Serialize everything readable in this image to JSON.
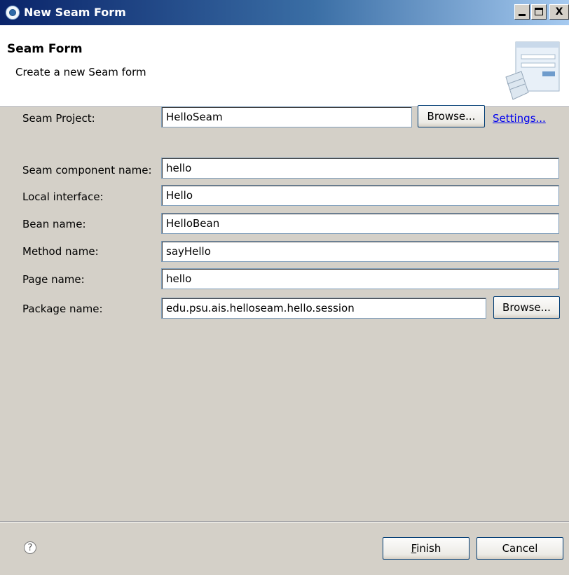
{
  "window": {
    "title": "New Seam Form",
    "controls": {
      "minimize": "_",
      "maximize": "□",
      "close": "X"
    }
  },
  "header": {
    "title": "Seam Form",
    "description": "Create a new Seam form",
    "graphic": "form-wizard-icon"
  },
  "form": {
    "fields": [
      {
        "label": "Seam Project:",
        "value": "HelloSeam"
      },
      {
        "label": "Seam component name:",
        "value": "hello"
      },
      {
        "label": "Local interface:",
        "value": "Hello"
      },
      {
        "label": "Bean name:",
        "value": "HelloBean"
      },
      {
        "label": "Method name:",
        "value": "sayHello"
      },
      {
        "label": "Page name:",
        "value": "hello"
      },
      {
        "label": "Package name:",
        "value": "edu.psu.ais.helloseam.hello.session"
      }
    ],
    "project_browse": "Browse...",
    "settings_link": "Settings...",
    "package_browse": "Browse..."
  },
  "footer": {
    "help_icon": "help-icon",
    "finish_accel": "F",
    "finish_rest": "inish",
    "cancel": "Cancel"
  },
  "colors": {
    "titlebar_start": "#0a246a",
    "titlebar_end": "#a6caf0",
    "dialog_bg": "#d4d0c8",
    "link": "#0000ee"
  }
}
